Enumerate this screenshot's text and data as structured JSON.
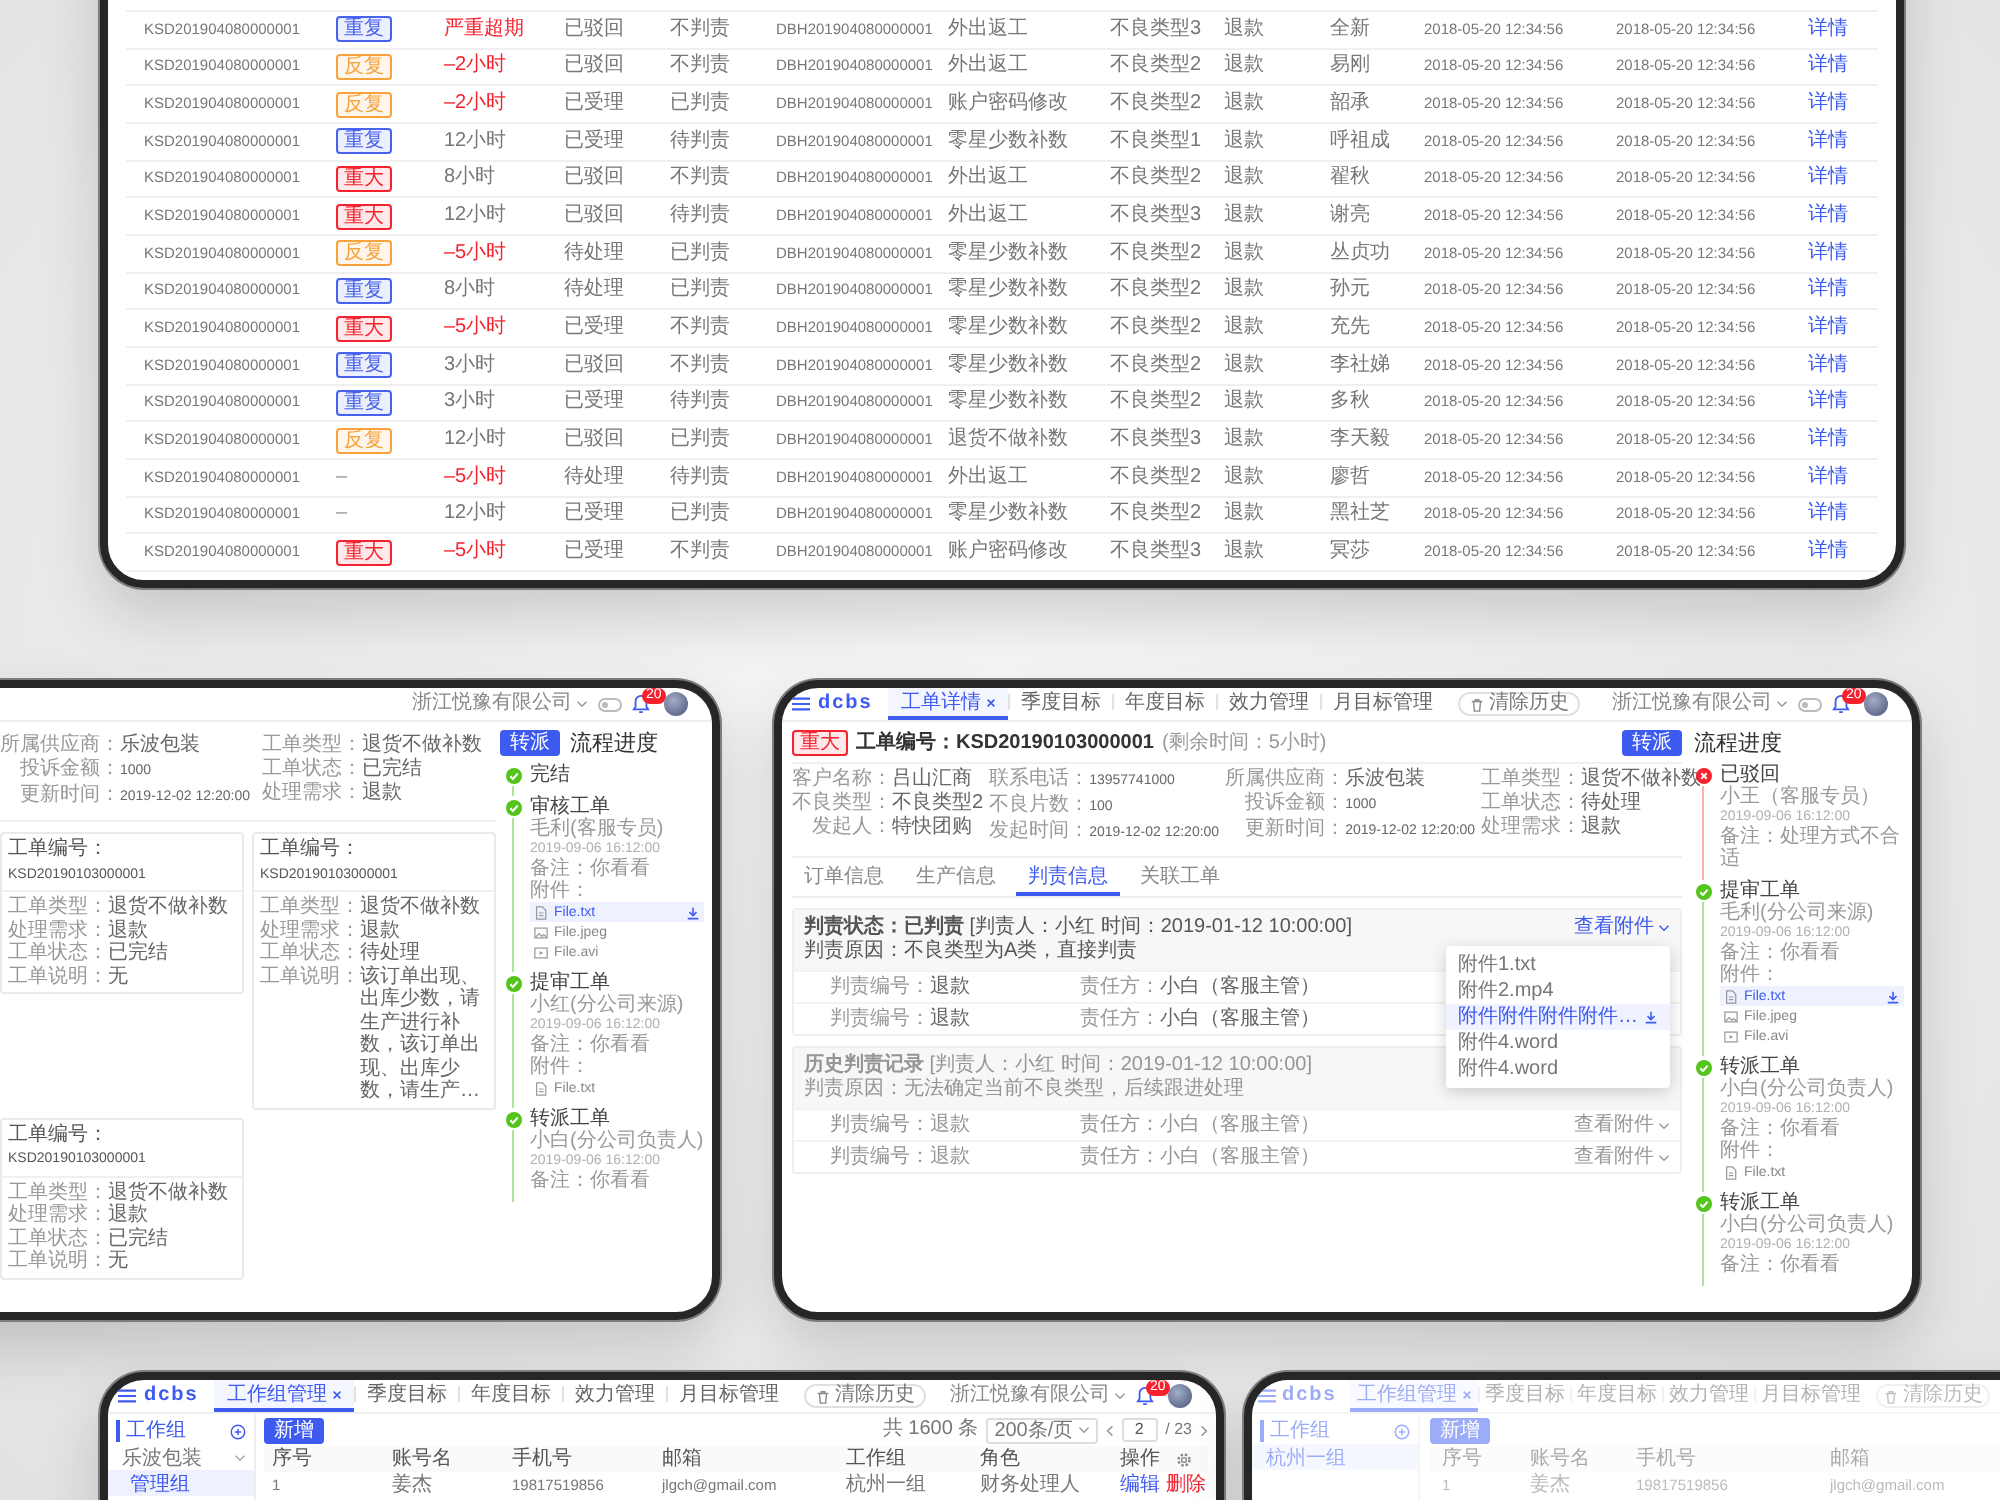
{
  "order_table": {
    "rows": [
      {
        "order_no": "KSD201904080000001",
        "tag": {
          "label": "重复",
          "color": "#4763ee"
        },
        "time_left": "严重超期",
        "overdue": true,
        "status": "已驳回",
        "judgment": "不判责",
        "ticket_no": "DBH201904080000001",
        "type": "外出返工",
        "defect": "不良类型3",
        "demand": "退款",
        "handler": "全新",
        "created": "2018-05-20 12:34:56",
        "updated": "2018-05-20 12:34:56",
        "action": "详情"
      },
      {
        "order_no": "KSD201904080000001",
        "tag": {
          "label": "反复",
          "color": "#f7a23b"
        },
        "time_left": "–2小时",
        "overdue": true,
        "status": "已驳回",
        "judgment": "不判责",
        "ticket_no": "DBH201904080000001",
        "type": "外出返工",
        "defect": "不良类型2",
        "demand": "退款",
        "handler": "易刚",
        "created": "2018-05-20 12:34:56",
        "updated": "2018-05-20 12:34:56",
        "action": "详情"
      },
      {
        "order_no": "KSD201904080000001",
        "tag": {
          "label": "反复",
          "color": "#f7a23b"
        },
        "time_left": "–2小时",
        "overdue": true,
        "status": "已受理",
        "judgment": "已判责",
        "ticket_no": "DBH201904080000001",
        "type": "账户密码修改",
        "defect": "不良类型2",
        "demand": "退款",
        "handler": "韶承",
        "created": "2018-05-20 12:34:56",
        "updated": "2018-05-20 12:34:56",
        "action": "详情"
      },
      {
        "order_no": "KSD201904080000001",
        "tag": {
          "label": "重复",
          "color": "#4763ee"
        },
        "time_left": "12小时",
        "overdue": false,
        "status": "已受理",
        "judgment": "待判责",
        "ticket_no": "DBH201904080000001",
        "type": "零星少数补数",
        "defect": "不良类型1",
        "demand": "退款",
        "handler": "呼祖成",
        "created": "2018-05-20 12:34:56",
        "updated": "2018-05-20 12:34:56",
        "action": "详情"
      },
      {
        "order_no": "KSD201904080000001",
        "tag": {
          "label": "重大",
          "color": "#f5222d"
        },
        "time_left": "8小时",
        "overdue": false,
        "status": "已驳回",
        "judgment": "不判责",
        "ticket_no": "DBH201904080000001",
        "type": "外出返工",
        "defect": "不良类型2",
        "demand": "退款",
        "handler": "翟秋",
        "created": "2018-05-20 12:34:56",
        "updated": "2018-05-20 12:34:56",
        "action": "详情"
      },
      {
        "order_no": "KSD201904080000001",
        "tag": {
          "label": "重大",
          "color": "#f5222d"
        },
        "time_left": "12小时",
        "overdue": false,
        "status": "已驳回",
        "judgment": "待判责",
        "ticket_no": "DBH201904080000001",
        "type": "外出返工",
        "defect": "不良类型3",
        "demand": "退款",
        "handler": "谢亮",
        "created": "2018-05-20 12:34:56",
        "updated": "2018-05-20 12:34:56",
        "action": "详情"
      },
      {
        "order_no": "KSD201904080000001",
        "tag": {
          "label": "反复",
          "color": "#f7a23b"
        },
        "time_left": "–5小时",
        "overdue": true,
        "status": "待处理",
        "judgment": "已判责",
        "ticket_no": "DBH201904080000001",
        "type": "零星少数补数",
        "defect": "不良类型2",
        "demand": "退款",
        "handler": "丛贞功",
        "created": "2018-05-20 12:34:56",
        "updated": "2018-05-20 12:34:56",
        "action": "详情"
      },
      {
        "order_no": "KSD201904080000001",
        "tag": {
          "label": "重复",
          "color": "#4763ee"
        },
        "time_left": "8小时",
        "overdue": false,
        "status": "待处理",
        "judgment": "已判责",
        "ticket_no": "DBH201904080000001",
        "type": "零星少数补数",
        "defect": "不良类型2",
        "demand": "退款",
        "handler": "孙元",
        "created": "2018-05-20 12:34:56",
        "updated": "2018-05-20 12:34:56",
        "action": "详情"
      },
      {
        "order_no": "KSD201904080000001",
        "tag": {
          "label": "重大",
          "color": "#f5222d"
        },
        "time_left": "–5小时",
        "overdue": true,
        "status": "已受理",
        "judgment": "不判责",
        "ticket_no": "DBH201904080000001",
        "type": "零星少数补数",
        "defect": "不良类型2",
        "demand": "退款",
        "handler": "充先",
        "created": "2018-05-20 12:34:56",
        "updated": "2018-05-20 12:34:56",
        "action": "详情"
      },
      {
        "order_no": "KSD201904080000001",
        "tag": {
          "label": "重复",
          "color": "#4763ee"
        },
        "time_left": "3小时",
        "overdue": false,
        "status": "已驳回",
        "judgment": "不判责",
        "ticket_no": "DBH201904080000001",
        "type": "零星少数补数",
        "defect": "不良类型2",
        "demand": "退款",
        "handler": "李社娣",
        "created": "2018-05-20 12:34:56",
        "updated": "2018-05-20 12:34:56",
        "action": "详情"
      },
      {
        "order_no": "KSD201904080000001",
        "tag": {
          "label": "重复",
          "color": "#4763ee"
        },
        "time_left": "3小时",
        "overdue": false,
        "status": "已受理",
        "judgment": "待判责",
        "ticket_no": "DBH201904080000001",
        "type": "零星少数补数",
        "defect": "不良类型2",
        "demand": "退款",
        "handler": "多秋",
        "created": "2018-05-20 12:34:56",
        "updated": "2018-05-20 12:34:56",
        "action": "详情"
      },
      {
        "order_no": "KSD201904080000001",
        "tag": {
          "label": "反复",
          "color": "#f7a23b"
        },
        "time_left": "12小时",
        "overdue": false,
        "status": "已驳回",
        "judgment": "已判责",
        "ticket_no": "DBH201904080000001",
        "type": "退货不做补数",
        "defect": "不良类型3",
        "demand": "退款",
        "handler": "李天毅",
        "created": "2018-05-20 12:34:56",
        "updated": "2018-05-20 12:34:56",
        "action": "详情"
      },
      {
        "order_no": "KSD201904080000001",
        "tag": {
          "label": "–"
        },
        "time_left": "–5小时",
        "overdue": true,
        "status": "待处理",
        "judgment": "待判责",
        "ticket_no": "DBH201904080000001",
        "type": "外出返工",
        "defect": "不良类型2",
        "demand": "退款",
        "handler": "廖哲",
        "created": "2018-05-20 12:34:56",
        "updated": "2018-05-20 12:34:56",
        "action": "详情"
      },
      {
        "order_no": "KSD201904080000001",
        "tag": {
          "label": "–"
        },
        "time_left": "12小时",
        "overdue": false,
        "status": "已受理",
        "judgment": "已判责",
        "ticket_no": "DBH201904080000001",
        "type": "零星少数补数",
        "defect": "不良类型2",
        "demand": "退款",
        "handler": "黑社芝",
        "created": "2018-05-20 12:34:56",
        "updated": "2018-05-20 12:34:56",
        "action": "详情"
      },
      {
        "order_no": "KSD201904080000001",
        "tag": {
          "label": "重大",
          "color": "#f5222d"
        },
        "time_left": "–5小时",
        "overdue": true,
        "status": "已受理",
        "judgment": "不判责",
        "ticket_no": "DBH201904080000001",
        "type": "账户密码修改",
        "defect": "不良类型3",
        "demand": "退款",
        "handler": "冥莎",
        "created": "2018-05-20 12:34:56",
        "updated": "2018-05-20 12:34:56",
        "action": "详情"
      }
    ]
  },
  "detail_left": {
    "topbar": {
      "company": "浙江悦豫有限公司",
      "toggle_on": false,
      "notifications": "20"
    },
    "forward_button": "转派",
    "progress_title": "流程进度",
    "info_columns": [
      [
        {
          "label": "所属供应商：",
          "value": "乐波包装"
        },
        {
          "label": "投诉金额：",
          "value": "1000"
        },
        {
          "label": "更新时间：",
          "value": "2019-12-02 12:20:00"
        }
      ],
      [
        {
          "label": "工单类型：",
          "value": "退货不做补数"
        },
        {
          "label": "工单状态：",
          "value": "已完结"
        },
        {
          "label": "处理需求：",
          "value": "退款"
        }
      ]
    ],
    "cards": [
      {
        "title": {
          "label": "工单编号：",
          "value": "KSD20190103000001"
        },
        "fields": [
          {
            "label": "工单类型：",
            "value": "退货不做补数"
          },
          {
            "label": "处理需求：",
            "value": "退款"
          },
          {
            "label": "工单状态：",
            "value": "已完结"
          },
          {
            "label": "工单说明：",
            "value": "无"
          }
        ]
      },
      {
        "title": {
          "label": "工单编号：",
          "value": "KSD20190103000001"
        },
        "fields": [
          {
            "label": "工单类型：",
            "value": "退货不做补数"
          },
          {
            "label": "处理需求：",
            "value": "退款"
          },
          {
            "label": "工单状态：",
            "value": "待处理"
          },
          {
            "label": "工单说明：",
            "value": "该订单出现、出库少数，请生产进行补数，该订单出现、出库少数，请生产…"
          }
        ]
      },
      {
        "title": {
          "label": "工单编号：",
          "value": "KSD20190103000001"
        },
        "fields": [
          {
            "label": "工单类型：",
            "value": "退货不做补数"
          },
          {
            "label": "处理需求：",
            "value": "退款"
          },
          {
            "label": "工单状态：",
            "value": "已完结"
          },
          {
            "label": "工单说明：",
            "value": "无"
          }
        ]
      }
    ],
    "timeline": [
      {
        "title": "完结",
        "rejected": false
      },
      {
        "title": "审核工单",
        "rejected": false,
        "person": "毛利(客服专员)",
        "time": "2019-09-06 16:12:00",
        "note": "备注：你看看",
        "attachments_label": "附件：",
        "files": [
          {
            "name": "File.txt",
            "kind": "document",
            "selected": true
          },
          {
            "name": "File.jpeg",
            "kind": "image",
            "selected": false
          },
          {
            "name": "File.avi",
            "kind": "video",
            "selected": false
          }
        ]
      },
      {
        "title": "提审工单",
        "rejected": false,
        "person": "小红(分公司来源)",
        "time": "2019-09-06 16:12:00",
        "note": "备注：你看看",
        "attachments_label": "附件：",
        "files": [
          {
            "name": "File.txt",
            "kind": "document",
            "selected": false
          }
        ]
      },
      {
        "title": "转派工单",
        "rejected": false,
        "person": "小白(分公司负责人)",
        "time": "2019-09-06 16:12:00",
        "note": "备注：你看看"
      }
    ]
  },
  "detail_right": {
    "logo": "dcbs",
    "topbar": {
      "tabs": [
        {
          "label": "工单详情",
          "selected": true
        },
        {
          "label": "季度目标",
          "selected": false
        },
        {
          "label": "年度目标",
          "selected": false
        },
        {
          "label": "效力管理",
          "selected": false
        },
        {
          "label": "月目标管理",
          "selected": false
        }
      ],
      "clear_button": "清除历史",
      "company": "浙江悦豫有限公司",
      "toggle_on": false,
      "notifications": "20"
    },
    "title": {
      "tag": {
        "label": "重大",
        "color": "#f5222d"
      },
      "text": "工单编号：KSD20190103000001",
      "remaining": "(剩余时间：5小时)"
    },
    "forward_button": "转派",
    "progress_title": "流程进度",
    "info_columns": [
      [
        {
          "label": "客户名称：",
          "value": "吕山汇商"
        },
        {
          "label": "不良类型：",
          "value": "不良类型2"
        },
        {
          "label": "发起人：",
          "value": "特快团购"
        }
      ],
      [
        {
          "label": "联系电话：",
          "value": "13957741000"
        },
        {
          "label": "不良片数：",
          "value": "100"
        },
        {
          "label": "发起时间：",
          "value": "2019-12-02 12:20:00"
        }
      ],
      [
        {
          "label": "所属供应商：",
          "value": "乐波包装"
        },
        {
          "label": "投诉金额：",
          "value": "1000"
        },
        {
          "label": "更新时间：",
          "value": "2019-12-02 12:20:00"
        }
      ],
      [
        {
          "label": "工单类型：",
          "value": "退货不做补数"
        },
        {
          "label": "工单状态：",
          "value": "待处理"
        },
        {
          "label": "处理需求：",
          "value": "退款"
        }
      ]
    ],
    "section_tabs": [
      {
        "label": "订单信息",
        "selected": false
      },
      {
        "label": "生产信息",
        "selected": false
      },
      {
        "label": "判责信息",
        "selected": true
      },
      {
        "label": "关联工单",
        "selected": false
      }
    ],
    "panels": [
      {
        "kind": "current",
        "heading": "**判责状态：已判责** [判责人：小红  时间：2019-01-12 10:00:00]",
        "reason": "判责原因：不良类型为A类，直接判责",
        "attachments": "查看附件",
        "attachment_menu": [
          {
            "label": "附件1.txt",
            "selected": false
          },
          {
            "label": "附件2.mp4",
            "selected": false
          },
          {
            "label": "附件附件附件附件…",
            "selected": true
          },
          {
            "label": "附件4.word",
            "selected": false
          },
          {
            "label": "附件4.word",
            "selected": false
          }
        ],
        "rows": [
          {
            "fields": [
              {
                "label": "判责编号：",
                "value": "退款"
              },
              {
                "label": "责任方：",
                "value": "小白（客服主管）"
              }
            ]
          },
          {
            "fields": [
              {
                "label": "判责编号：",
                "value": "退款"
              },
              {
                "label": "责任方：",
                "value": "小白（客服主管）"
              }
            ]
          }
        ]
      },
      {
        "kind": "history",
        "heading": "**历史判责记录** [判责人：小红  时间：2019-01-12 10:00:00]",
        "reason": "判责原因：无法确定当前不良类型，后续跟进处理",
        "rows": [
          {
            "fields": [
              {
                "label": "判责编号：",
                "value": "退款"
              },
              {
                "label": "责任方：",
                "value": "小白（客服主管）"
              }
            ],
            "attachments": "查看附件"
          },
          {
            "fields": [
              {
                "label": "判责编号：",
                "value": "退款"
              },
              {
                "label": "责任方：",
                "value": "小白（客服主管）"
              }
            ],
            "attachments": "查看附件"
          }
        ]
      }
    ],
    "timeline": [
      {
        "title": "已驳回",
        "rejected": true,
        "person": "小王（客服专员）",
        "time": "2019-09-06 16:12:00",
        "note": "备注：处理方式不合适"
      },
      {
        "title": "提审工单",
        "rejected": false,
        "person": "毛利(分公司来源)",
        "time": "2019-09-06 16:12:00",
        "note": "备注：你看看",
        "attachments_label": "附件：",
        "files": [
          {
            "name": "File.txt",
            "kind": "document",
            "selected": true
          },
          {
            "name": "File.jpeg",
            "kind": "image",
            "selected": false
          },
          {
            "name": "File.avi",
            "kind": "video",
            "selected": false
          }
        ]
      },
      {
        "title": "转派工单",
        "rejected": false,
        "person": "小白(分公司负责人)",
        "time": "2019-09-06 16:12:00",
        "note": "备注：你看看",
        "attachments_label": "附件：",
        "files": [
          {
            "name": "File.txt",
            "kind": "document",
            "selected": false
          }
        ]
      },
      {
        "title": "转派工单",
        "rejected": false,
        "person": "小白(分公司负责人)",
        "time": "2019-09-06 16:12:00",
        "note": "备注：你看看"
      }
    ]
  },
  "group_admin": {
    "logo": "dcbs",
    "topbar": {
      "tabs": [
        {
          "label": "工作组管理",
          "selected": true
        },
        {
          "label": "季度目标",
          "selected": false
        },
        {
          "label": "年度目标",
          "selected": false
        },
        {
          "label": "效力管理",
          "selected": false
        },
        {
          "label": "月目标管理",
          "selected": false
        }
      ],
      "clear_button": "清除历史",
      "company": "浙江悦豫有限公司",
      "notifications": "20"
    },
    "sidebar": {
      "title": "工作组",
      "items": [
        {
          "label": "乐波包装",
          "expanded": true,
          "selected": false,
          "children": [
            {
              "label": "管理组",
              "selected": true
            }
          ]
        }
      ]
    },
    "add_button": "新增",
    "pagination": {
      "total": "共 1600 条",
      "page_size": "200条/页",
      "page": "2",
      "page_count": "/ 23"
    },
    "table": {
      "columns": [
        "序号",
        "账号名",
        "手机号",
        "邮箱",
        "工作组",
        "角色",
        "操作"
      ],
      "rows": [
        {
          "cells": [
            "1",
            "姜杰",
            "19817519856",
            "jlgch@gmail.com",
            "杭州一组",
            "财务处理人"
          ],
          "actions": [
            {
              "label": "编辑",
              "kind": "edit"
            },
            {
              "label": "删除",
              "kind": "delete"
            }
          ]
        }
      ]
    }
  },
  "group_admin_dimmed": {
    "dimmed": true,
    "logo": "dcbs",
    "topbar": {
      "tabs": [
        {
          "label": "工作组管理",
          "selected": true
        },
        {
          "label": "季度目标",
          "selected": false
        },
        {
          "label": "年度目标",
          "selected": false
        },
        {
          "label": "效力管理",
          "selected": false
        },
        {
          "label": "月目标管理",
          "selected": false
        }
      ],
      "clear_button": "清除历史"
    },
    "sidebar": {
      "title": "工作组",
      "items": [
        {
          "label": "杭州一组",
          "selected": true
        }
      ]
    },
    "add_button": "新增",
    "table": {
      "columns": [
        "序号",
        "账号名",
        "手机号",
        "邮箱"
      ],
      "rows": [
        {
          "cells": [
            "1",
            "姜杰",
            "19817519856",
            "jlgch@gmail.com"
          ]
        }
      ]
    }
  }
}
